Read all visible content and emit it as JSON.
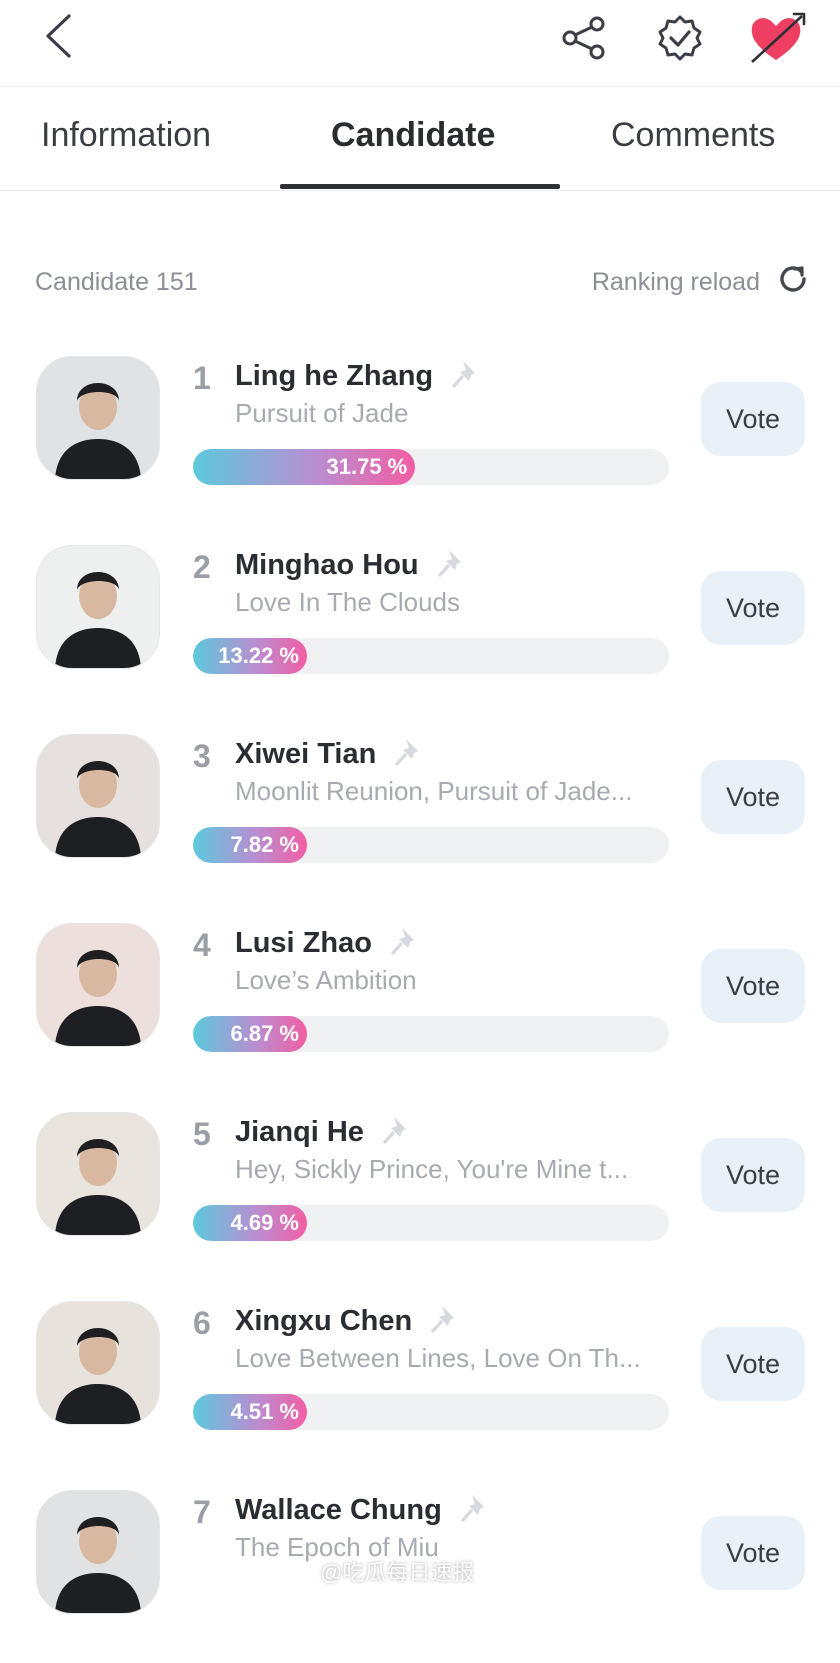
{
  "tabs": {
    "information": "Information",
    "candidate": "Candidate",
    "comments": "Comments"
  },
  "meta": {
    "candidate_count": "Candidate 151",
    "ranking_reload": "Ranking reload"
  },
  "colors": {
    "bar_start": "#5cc9dd",
    "bar_end": "#f25ea4",
    "vote_bg": "#e9f1f8",
    "heart": "#ee3f62"
  },
  "candidates": [
    {
      "rank": "1",
      "name": "Ling he Zhang",
      "works": "Pursuit of Jade",
      "percent_label": "31.75 %",
      "percent": 31.75,
      "vote_label": "Vote"
    },
    {
      "rank": "2",
      "name": "Minghao Hou",
      "works": "Love In The Clouds",
      "percent_label": "13.22 %",
      "percent": 13.22,
      "vote_label": "Vote"
    },
    {
      "rank": "3",
      "name": "Xiwei Tian",
      "works": "Moonlit Reunion, Pursuit of Jade...",
      "percent_label": "7.82 %",
      "percent": 7.82,
      "vote_label": "Vote"
    },
    {
      "rank": "4",
      "name": "Lusi Zhao",
      "works": "Love’s Ambition",
      "percent_label": "6.87 %",
      "percent": 6.87,
      "vote_label": "Vote"
    },
    {
      "rank": "5",
      "name": "Jianqi He",
      "works": "Hey, Sickly Prince, You're Mine t...",
      "percent_label": "4.69 %",
      "percent": 4.69,
      "vote_label": "Vote"
    },
    {
      "rank": "6",
      "name": "Xingxu Chen",
      "works": "Love Between Lines, Love On Th...",
      "percent_label": "4.51 %",
      "percent": 4.51,
      "vote_label": "Vote"
    },
    {
      "rank": "7",
      "name": "Wallace Chung",
      "works": "The Epoch of Miu",
      "percent_label": "",
      "percent": null,
      "vote_label": "Vote"
    }
  ],
  "watermark": "@吃瓜每日速报"
}
